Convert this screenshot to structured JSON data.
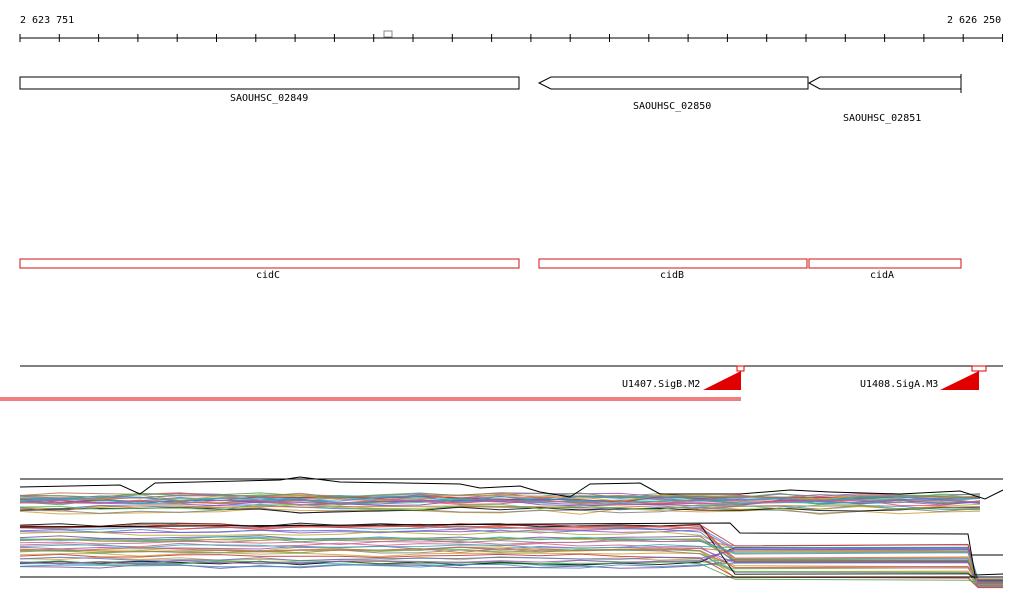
{
  "ruler": {
    "start_label": "2 623 751",
    "end_label": "2 626 250"
  },
  "genes": {
    "g1": "SAOUHSC_02849",
    "g2": "SAOUHSC_02850",
    "g3": "SAOUHSC_02851"
  },
  "features": {
    "f1": "cidC",
    "f2": "cidB",
    "f3": "cidA"
  },
  "promoters": {
    "p1": "U1407.SigB.M2",
    "p2": "U1408.SigA.M3"
  },
  "colors": {
    "gene_stroke": "#000000",
    "feature_stroke": "#d01010",
    "promoter_red": "#e00000"
  }
}
